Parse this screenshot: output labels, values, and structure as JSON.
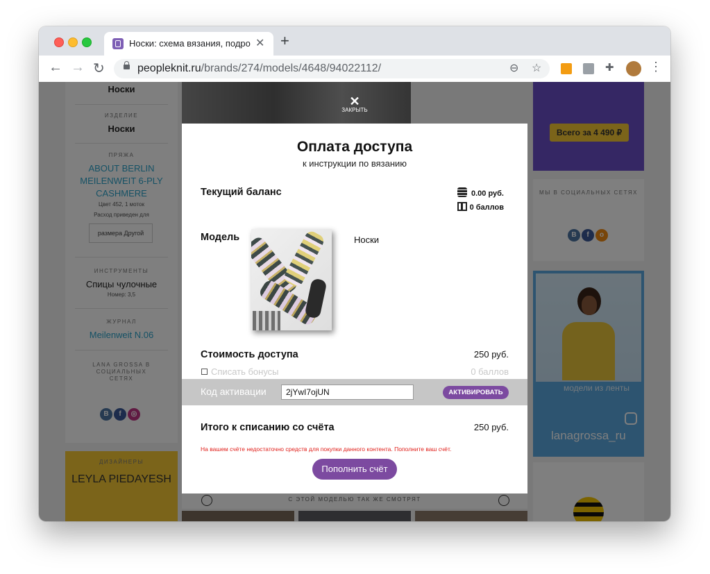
{
  "browser": {
    "tab_title": "Носки: схема вязания, подро",
    "url_host": "peopleknit.ru",
    "url_path": "/brands/274/models/4648/94022112/"
  },
  "background": {
    "left": {
      "top_name": "Носки",
      "item_caption": "ИЗДЕЛИЕ",
      "item_value": "Носки",
      "yarn_caption": "ПРЯЖА",
      "yarn_name": "ABOUT BERLIN MEILENWEIT 6-PLY CASHMERE",
      "yarn_color": "Цвет 452, 1 моток",
      "yarn_note": "Расход приведен для",
      "size_button": "размера Другой",
      "tools_caption": "ИНСТРУМЕНТЫ",
      "tools_value": "Спицы чулочные",
      "tools_number": "Номер: 3,5",
      "journal_caption": "ЖУРНАЛ",
      "journal_value": "Meilenweit N.06",
      "brand_social_caption": "LANA GROSSA В СОЦИАЛЬНЫХ СЕТЯХ",
      "designers_caption": "ДИЗАЙНЕРЫ",
      "designer_name": "LEYLA PIEDAYESH"
    },
    "right": {
      "ad_button": "Всего за 4 490 ₽",
      "social_caption": "МЫ В СОЦИАЛЬНЫХ СЕТЯХ",
      "feed_label": "модели из ленты",
      "handle": "lanagrossa_ru"
    },
    "related_caption": "С ЭТОЙ МОДЕЛЬЮ ТАК ЖЕ СМОТРЯТ"
  },
  "overlay": {
    "close_label": "ЗАКРЫТЬ",
    "close_glyph": "✕"
  },
  "modal": {
    "title": "Оплата доступа",
    "subtitle": "к инструкции по вязанию",
    "balance_label": "Текущий баланс",
    "balance_money": "0.00 руб.",
    "balance_points": "0 баллов",
    "model_label": "Модель",
    "model_name": "Носки",
    "cost_label": "Стоимость доступа",
    "cost_value": "250 руб.",
    "bonus_label": "Списать бонусы",
    "bonus_value": "0 баллов",
    "activation_label": "Код активации",
    "activation_code": "2jYwI7ojUN",
    "activate_button": "АКТИВИРОВАТЬ",
    "total_label": "Итого к списанию со счёта",
    "total_value": "250 руб.",
    "warning": "На вашем счёте недостаточно средств для покупки данного контента. Пополните ваш счёт.",
    "topup_button": "Пополнить счёт"
  },
  "colors": {
    "accent": "#7c4aa0",
    "warning": "#e0201b",
    "link": "#2ba3cb"
  }
}
